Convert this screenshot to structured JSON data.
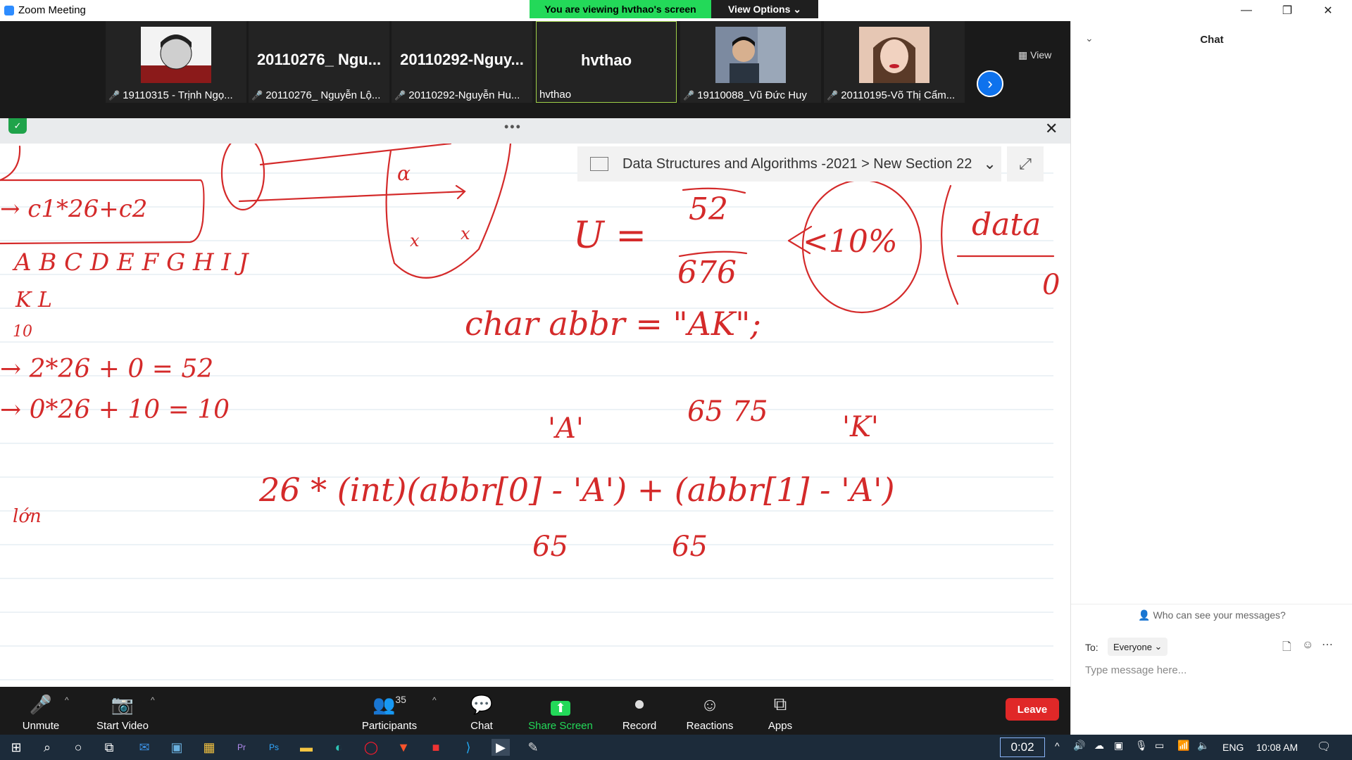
{
  "window": {
    "title": "Zoom Meeting"
  },
  "share_banner": {
    "viewing_text": "You are viewing hvthao's screen",
    "view_options": "View Options"
  },
  "participants_strip": {
    "tiles": [
      {
        "name": "19110315 - Trịnh Ngọ...",
        "big": ""
      },
      {
        "name": "20110276_ Nguyễn Lộ...",
        "big": "20110276_ Ngu..."
      },
      {
        "name": "20110292-Nguyễn Hu...",
        "big": "20110292-Nguy..."
      },
      {
        "name": "hvthao",
        "big": "hvthao"
      },
      {
        "name": "19110088_Vũ Đức Huy",
        "big": ""
      },
      {
        "name": "20110195-Võ Thị Cẩm...",
        "big": ""
      }
    ],
    "view_label": "View"
  },
  "onenote": {
    "breadcrumb": "Data Structures and Algorithms -2021 > New Section 22"
  },
  "handwriting": {
    "l1": "→ c1*26+c2",
    "l2": "A B C D E F G H I J",
    "l3": "K L",
    "l4": "10",
    "l5": "→ 2*26 + 0 = 52",
    "l6": "→ 0*26 + 10 = 10",
    "u_eq": "U =",
    "num": "52",
    "den": "676",
    "pct": "<10%",
    "data": "data",
    "code": "char abbr = \"AK\";",
    "codes": "65 75",
    "qa": "'A'",
    "qk": "'K'",
    "expr": "26 * (int)(abbr[0] - 'A') + (abbr[1] - 'A')",
    "s65a": "65",
    "s65b": "65",
    "alpha": "α",
    "lon": "lớn",
    "c0": "0",
    "x1": "x",
    "x2": "x"
  },
  "chat": {
    "title": "Chat",
    "who": "Who can see your messages?",
    "to_label": "To:",
    "recipient": "Everyone",
    "placeholder": "Type message here..."
  },
  "toolbar": {
    "unmute": "Unmute",
    "start_video": "Start Video",
    "participants": "Participants",
    "participant_count": "35",
    "chat": "Chat",
    "share_screen": "Share Screen",
    "record": "Record",
    "reactions": "Reactions",
    "apps": "Apps",
    "leave": "Leave"
  },
  "taskbar": {
    "timer": "0:02",
    "lang": "ENG",
    "time": "10:08 AM"
  },
  "colors": {
    "ink": "#d42a2a",
    "share_green": "#23d959",
    "leave_red": "#e02828",
    "zoom_blue": "#0e72ed"
  }
}
